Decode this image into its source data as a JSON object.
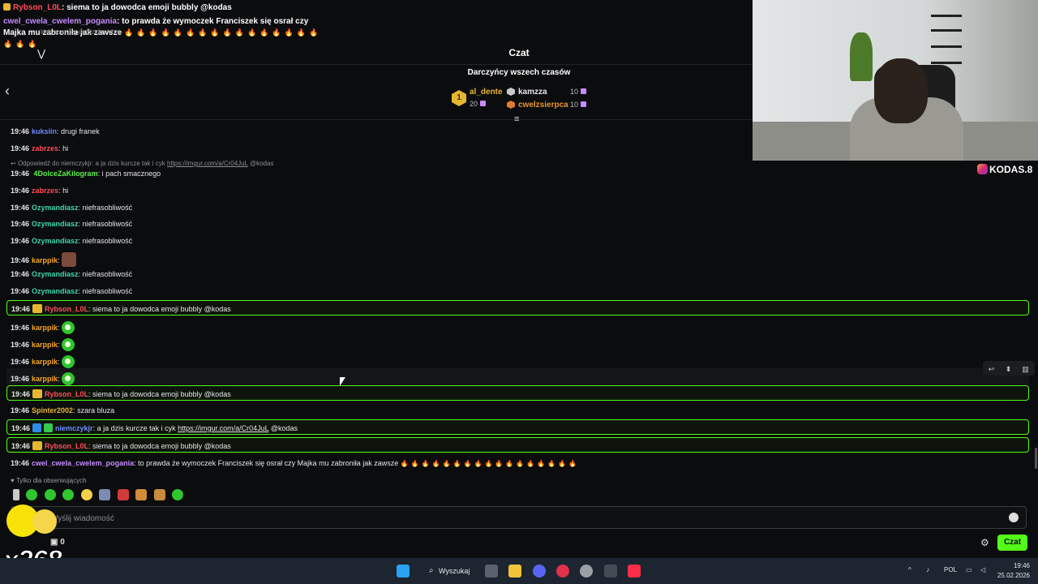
{
  "overlay": {
    "line1_user": "Rybson_L0L",
    "line1_text": ": siema to ja dowodca emoji bubbly @kodas",
    "line2_user": "cwel_cwela_cwelem_pogania",
    "line2_text": ": to prawda że wymoczek Franciszek się osrał czy",
    "line3_text": "Majka mu zabroniła jak zawsze",
    "line3_flames": "🔥🔥🔥🔥🔥🔥🔥🔥🔥🔥🔥🔥🔥🔥🔥🔥",
    "line4_flames": "🔥🔥🔥",
    "url": "kick.com/popout/kodas/chat"
  },
  "header": {
    "title": "Czat"
  },
  "gifters": {
    "title": "Darczyńcy wszech czasów",
    "list": [
      {
        "rank": "1",
        "name": "al_dente",
        "count": "20"
      },
      {
        "name": "kamzza",
        "count": "10"
      },
      {
        "name": "cwelzsierpca",
        "count": "10"
      }
    ]
  },
  "stream": {
    "instagram": "KODAS.8"
  },
  "messages": [
    {
      "time": "19:46",
      "user": "kuksiin",
      "text": ": drugi franek",
      "color": "#6d8bff"
    },
    {
      "time": "19:46",
      "user": "zabrzes",
      "text": ": hi",
      "color": "#ff4c5c"
    },
    {
      "time": "19:46",
      "user": "4DolceZaKilogram",
      "text": ": i pach smacznego",
      "color": "#5ef04b"
    },
    {
      "time": "19:46",
      "user": "zabrzes",
      "text": ": hi",
      "color": "#ff4c5c"
    },
    {
      "time": "19:46",
      "user": "Ozymandiasz",
      "text": ": niefrasobliwość",
      "color": "#3fd7a8"
    },
    {
      "time": "19:46",
      "user": "Ozymandiasz",
      "text": ": niefrasobliwość",
      "color": "#3fd7a8"
    },
    {
      "time": "19:46",
      "user": "Ozymandiasz",
      "text": ": niefrasobliwość",
      "color": "#3fd7a8"
    },
    {
      "time": "19:46",
      "user": "karppik",
      "text": ":",
      "color": "#f5a623"
    },
    {
      "time": "19:46",
      "user": "Ozymandiasz",
      "text": ": niefrasobliwość",
      "color": "#3fd7a8"
    },
    {
      "time": "19:46",
      "user": "Ozymandiasz",
      "text": ": niefrasobliwość",
      "color": "#3fd7a8"
    },
    {
      "time": "19:46",
      "user": "Rybson_L0L",
      "text": ": siema to ja dowodca emoji bubbly @kodas",
      "color": "#ff4c5c"
    },
    {
      "time": "19:46",
      "user": "karppik",
      "text": ":",
      "color": "#f5a623"
    },
    {
      "time": "19:46",
      "user": "karppik",
      "text": ":",
      "color": "#f5a623"
    },
    {
      "time": "19:46",
      "user": "karppik",
      "text": ":",
      "color": "#f5a623"
    },
    {
      "time": "19:46",
      "user": "karppik",
      "text": ":",
      "color": "#f5a623"
    },
    {
      "time": "19:46",
      "user": "Rybson_L0L",
      "text": ": siema to ja dowodca emoji bubbly @kodas",
      "color": "#ff4c5c"
    },
    {
      "time": "19:46",
      "user": "Spinter2002",
      "text": ": szara bluza",
      "color": "#e7b631"
    },
    {
      "time": "19:46",
      "user": "niemczykjr",
      "text_pre": ": a ja dzis kurcze tak i cyk ",
      "link": "https://imgur.com/a/Cr04JuL",
      "text_post": " @kodas",
      "color": "#6d8bff"
    },
    {
      "time": "19:46",
      "user": "Rybson_L0L",
      "text": ": siema to ja dowodca emoji bubbly @kodas",
      "color": "#ff4c5c"
    },
    {
      "time": "19:46",
      "user": "cwel_cwela_cwelem_pogania",
      "text": ": to prawda że wymoczek Franciszek się osrał czy Majka mu zabroniła jak zawsze",
      "flames": "🔥🔥🔥🔥🔥🔥🔥🔥🔥🔥🔥🔥🔥🔥🔥🔥🔥",
      "color": "#c58bff"
    }
  ],
  "reply": {
    "text": "Odpowiedź do niemczykjr: a ja dzis kurcze tak i cyk ",
    "link": "https://imgur.com/a/Cr04JuL",
    "suffix": " @kodas"
  },
  "input": {
    "follower_note": "Tylko dla obserwujących",
    "placeholder": "Wyślij wiadomość",
    "points": "0",
    "send_label": "Czat",
    "combo": "x268"
  },
  "taskbar": {
    "search_label": "Wyszukaj",
    "lang": "POL",
    "time": "19:46",
    "date": "25.02.2026"
  },
  "colors": {
    "accent": "#53fc18",
    "background": "#0b0c0e"
  }
}
